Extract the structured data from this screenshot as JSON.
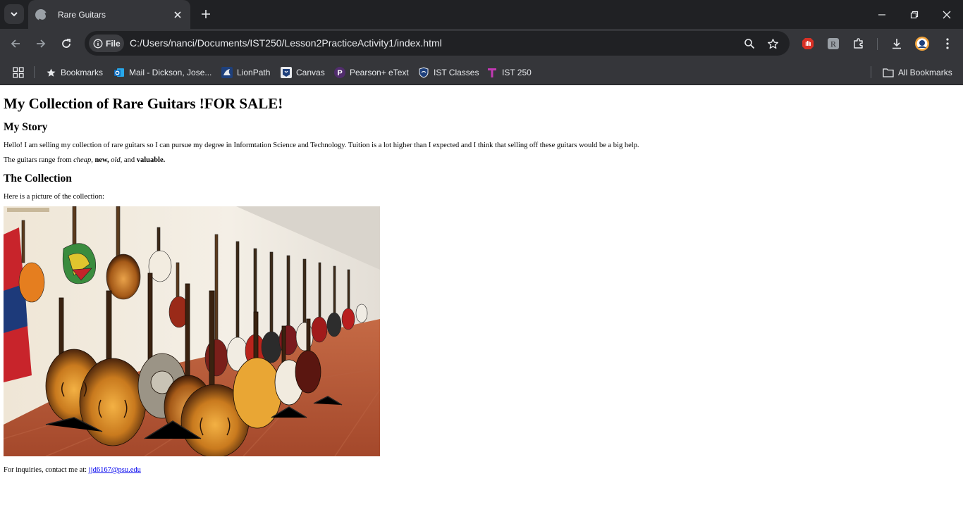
{
  "browser": {
    "tab": {
      "title": "Rare Guitars"
    },
    "omnibox": {
      "site_chip": "File",
      "url": "C:/Users/nanci/Documents/IST250/Lesson2PracticeActivity1/index.html"
    },
    "bookmarks": [
      {
        "label": "Bookmarks",
        "icon": "star-icon"
      },
      {
        "label": "Mail - Dickson, Jose...",
        "icon": "outlook-icon",
        "color": "#0f6cbd"
      },
      {
        "label": "LionPath",
        "icon": "lionpath-icon",
        "color": "#1e407c"
      },
      {
        "label": "Canvas",
        "icon": "canvas-icon",
        "color": "#1e407c"
      },
      {
        "label": "Pearson+ eText",
        "icon": "pearson-icon",
        "color": "#512d6d"
      },
      {
        "label": "IST Classes",
        "icon": "shield-icon",
        "color": "#1e407c"
      },
      {
        "label": "IST 250",
        "icon": "teams-icon",
        "color": "#c239b3"
      }
    ],
    "all_bookmarks": "All Bookmarks"
  },
  "page": {
    "title": "My Collection of Rare Guitars !FOR SALE!",
    "story_heading": "My Story",
    "story_text": "Hello! I am selling my collection of rare guitars so I can pursue my degree in Informtation Science and Technology. Tuition is a lot higher than I expected and I think that selling off these guitars would be a big help.",
    "range": {
      "prefix": "The guitars range from ",
      "cheap": "cheap,",
      "new": "new,",
      "old": "old,",
      "and": " and ",
      "valuable": "valuable."
    },
    "collection_heading": "The Collection",
    "collection_text": "Here is a picture of the collection:",
    "contact_prefix": "For inquiries, contact me at: ",
    "contact_email": "jjd6167@psu.edu"
  },
  "colors": {
    "tabstrip": "#202124",
    "toolbar": "#35363a",
    "link": "#0000ee"
  }
}
